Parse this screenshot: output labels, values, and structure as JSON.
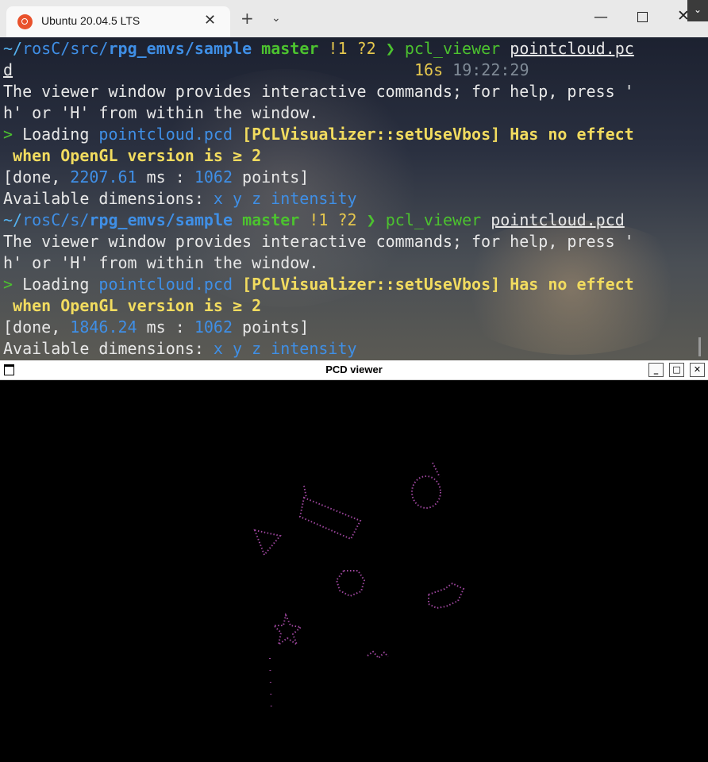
{
  "tab": {
    "title": "Ubuntu 20.04.5 LTS",
    "close_glyph": "✕",
    "new_tab_glyph": "+",
    "dropdown_glyph": "⌄",
    "icon": "ubuntu-icon"
  },
  "window_controls": {
    "minimize": "—",
    "close": "✕",
    "corner": "⌄"
  },
  "terminal": {
    "run1": {
      "cwd_home": "~/",
      "cwd_seg1": "rosC/",
      "cwd_seg2": "src/",
      "cwd_seg3": "rpg_emvs/",
      "cwd_seg4": "sample",
      "branch": "master",
      "status": "!1 ?2",
      "prompt_arrow": "❯",
      "cmd": "pcl_viewer",
      "arg": "pointcloud.pc",
      "arg_wrap": "d",
      "duration": "16s",
      "time": "19:22:29",
      "help1": "The viewer window provides interactive commands; for help, press '",
      "help2": "h' or 'H' from within the window.",
      "loading_marker": ">",
      "loading_label": " Loading ",
      "loading_file": "pointcloud.pcd",
      "warning1": " [PCLVisualizer::setUseVbos] Has no effect",
      "warning2": " when OpenGL version is ≥ 2",
      "done_prefix": "[done, ",
      "done_ms": "2207.61",
      "done_mid": " ms : ",
      "done_points": "1062",
      "done_suffix": " points]",
      "dims_label": "Available dimensions: ",
      "dims_value": "x y z intensity"
    },
    "run2": {
      "cwd_home": "~/",
      "cwd_seg1": "rosC/",
      "cwd_seg2": "s/",
      "cwd_seg3": "rpg_emvs/",
      "cwd_seg4": "sample",
      "branch": "master",
      "status": "!1 ?2",
      "prompt_arrow": "❯",
      "cmd": "pcl_viewer",
      "arg": "pointcloud.pcd",
      "help1": "The viewer window provides interactive commands; for help, press '",
      "help2": "h' or 'H' from within the window.",
      "loading_marker": ">",
      "loading_label": " Loading ",
      "loading_file": "pointcloud.pcd",
      "warning1": " [PCLVisualizer::setUseVbos] Has no effect",
      "warning2": " when OpenGL version is ≥ 2",
      "done_prefix": "[done, ",
      "done_ms": "1846.24",
      "done_mid": " ms : ",
      "done_points": "1062",
      "done_suffix": " points]",
      "dims_label": "Available dimensions: ",
      "dims_value": "x y z intensity"
    }
  },
  "pcd_viewer": {
    "title": "PCD viewer",
    "minimize": "_",
    "maximize": "□",
    "close": "✕",
    "point_color": "#a64aa6"
  }
}
